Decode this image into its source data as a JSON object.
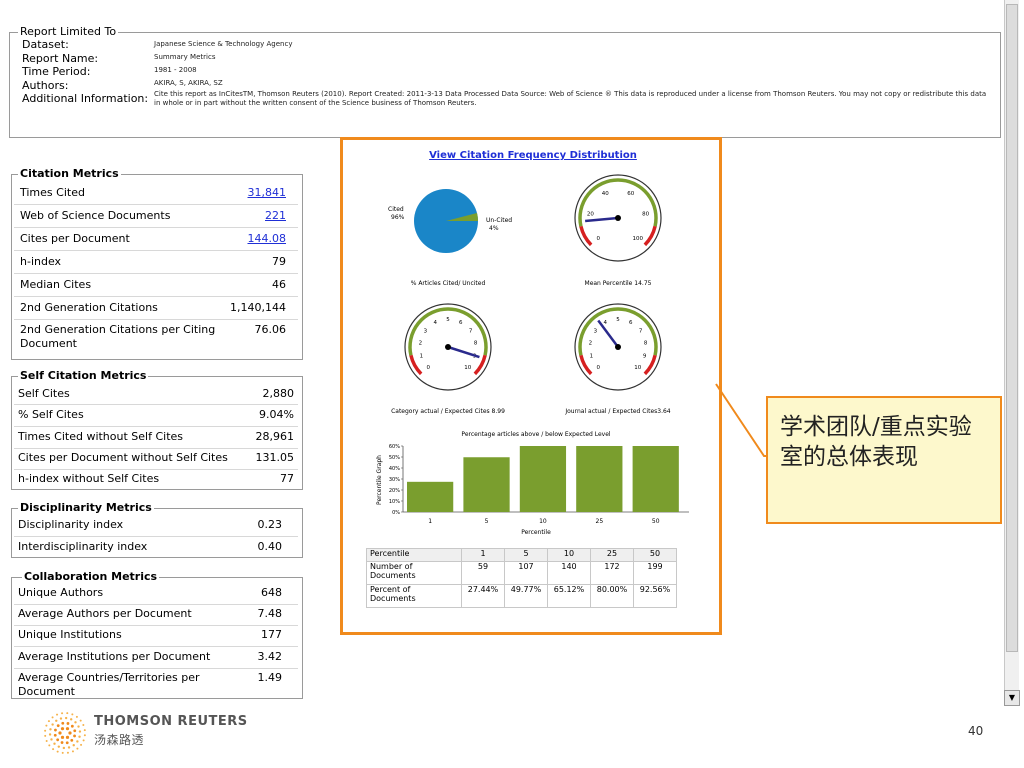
{
  "report": {
    "legend": "Report Limited To",
    "rows": [
      {
        "label": "Dataset:",
        "value": "Japanese Science & Technology Agency"
      },
      {
        "label": "Report Name:",
        "value": "Summary Metrics"
      },
      {
        "label": "Time Period:",
        "value": "1981 - 2008"
      },
      {
        "label": "Authors:",
        "value": "AKIRA, S, AKIRA, SZ"
      },
      {
        "label": "Additional Information:",
        "value": "Cite this report as InCitesTM, Thomson Reuters (2010). Report Created: 2011-3-13  Data Processed  Data Source: Web of Science ® This data is reproduced under a license from Thomson Reuters. You may not copy or redistribute this data in whole or in part without the written consent of the Science business of Thomson Reuters."
      }
    ]
  },
  "citation_metrics": {
    "legend": "Citation Metrics",
    "rows": [
      {
        "label": "Times Cited",
        "value": "31,841"
      },
      {
        "label": "Web of Science Documents",
        "value": "221"
      },
      {
        "label": "Cites per Document",
        "value": "144.08"
      },
      {
        "label": "h-index",
        "value": "79"
      },
      {
        "label": "Median Cites",
        "value": "46"
      },
      {
        "label": "2nd Generation Citations",
        "value": "1,140,144"
      },
      {
        "label": "2nd Generation Citations per Citing",
        "label2": "Document",
        "value": "76.06"
      }
    ]
  },
  "self_citation_metrics": {
    "legend": "Self Citation Metrics",
    "rows": [
      {
        "label": "Self Cites",
        "value": "2,880"
      },
      {
        "label": "% Self Cites",
        "value": "9.04%"
      },
      {
        "label": "Times Cited without Self Cites",
        "value": "28,961"
      },
      {
        "label": "Cites per Document without Self Cites",
        "value": "131.05"
      },
      {
        "label": "h-index without Self Cites",
        "value": "77"
      }
    ]
  },
  "disciplinarity_metrics": {
    "legend": "Disciplinarity Metrics",
    "rows": [
      {
        "label": "Disciplinarity index",
        "value": "0.23"
      },
      {
        "label": "Interdisciplinarity index",
        "value": "0.40"
      }
    ]
  },
  "collaboration_metrics": {
    "legend": "Collaboration Metrics",
    "rows": [
      {
        "label": "Unique Authors",
        "value": "648"
      },
      {
        "label": "Average Authors per Document",
        "value": "7.48"
      },
      {
        "label": "Unique Institutions",
        "value": "177"
      },
      {
        "label": "Average Institutions per Document",
        "value": "3.42"
      },
      {
        "label": "Average Countries/Territories per",
        "label2": "Document",
        "value": "1.49"
      }
    ]
  },
  "panel": {
    "link": "View Citation Frequency Distribution",
    "pie": {
      "cited_label": "Cited",
      "cited_pct": "96%",
      "uncited_label": "Un-Cited",
      "uncited_pct": "4%",
      "cited_value": 96,
      "uncited_value": 4,
      "caption": "% Articles Cited/ Uncited"
    },
    "gauge_mean": {
      "caption": "Mean Percentile 14.75",
      "value": 14.75,
      "ticks": [
        "0",
        "20",
        "40",
        "60",
        "80",
        "100"
      ]
    },
    "gauge_category": {
      "caption": "Category actual / Expected Cites 8.99",
      "value": 8.99,
      "ticks": [
        "0",
        "1",
        "2",
        "3",
        "4",
        "5",
        "6",
        "7",
        "8",
        "9",
        "10"
      ]
    },
    "gauge_journal": {
      "caption": "Journal actual / Expected Cites3.64",
      "value": 3.64,
      "ticks": [
        "0",
        "1",
        "2",
        "3",
        "4",
        "5",
        "6",
        "7",
        "8",
        "9",
        "10"
      ]
    }
  },
  "chart_data": {
    "type": "bar",
    "title": "Percentage articles above / below Expected Level",
    "xlabel": "Percentile",
    "ylabel": "Percentile Graph",
    "categories": [
      "1",
      "5",
      "10",
      "25",
      "50"
    ],
    "values": [
      27.44,
      49.77,
      65.12,
      80.0,
      92.56
    ],
    "ylim": [
      0,
      60
    ],
    "yticks": [
      "0%",
      "10%",
      "20%",
      "30%",
      "40%",
      "50%",
      "60%"
    ],
    "color": "#7a9e2e"
  },
  "table": {
    "header": [
      "Percentile",
      "1",
      "5",
      "10",
      "25",
      "50"
    ],
    "row1": [
      "Number of Documents",
      "59",
      "107",
      "140",
      "172",
      "199"
    ],
    "row2": [
      "Percent of Documents",
      "27.44%",
      "49.77%",
      "65.12%",
      "80.00%",
      "92.56%"
    ]
  },
  "callout": {
    "text": "学术团队/重点实验室的总体表现"
  },
  "footer": {
    "brand": "THOMSON REUTERS",
    "brand_cn": "汤森路透",
    "page": "40"
  },
  "colors": {
    "accent": "#f08a1c",
    "bar": "#7a9e2e",
    "pie": "#1a86c8",
    "link": "#1f2fd6",
    "needle": "#2a2a8c"
  }
}
